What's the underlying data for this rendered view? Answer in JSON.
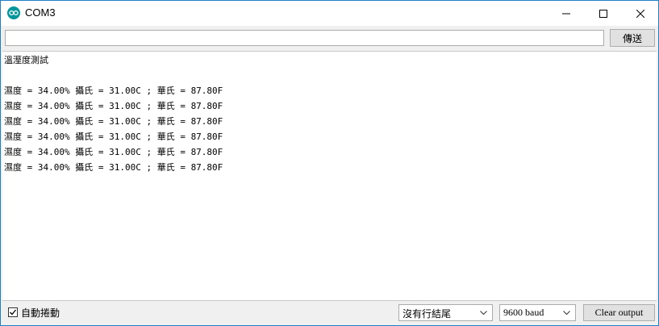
{
  "window": {
    "title": "COM3"
  },
  "send": {
    "input_value": "",
    "button_label": "傳送"
  },
  "output": {
    "lines": [
      "溫溼度測試",
      "",
      "濕度 = 34.00% 攝氏 = 31.00C ; 華氏 = 87.80F",
      "濕度 = 34.00% 攝氏 = 31.00C ; 華氏 = 87.80F",
      "濕度 = 34.00% 攝氏 = 31.00C ; 華氏 = 87.80F",
      "濕度 = 34.00% 攝氏 = 31.00C ; 華氏 = 87.80F",
      "濕度 = 34.00% 攝氏 = 31.00C ; 華氏 = 87.80F",
      "濕度 = 34.00% 攝氏 = 31.00C ; 華氏 = 87.80F"
    ]
  },
  "footer": {
    "autoscroll_label": "自動捲動",
    "autoscroll_checked": true,
    "line_ending": "沒有行結尾",
    "baud": "9600 baud",
    "clear_label": "Clear output"
  },
  "icons": {
    "app": "arduino-icon",
    "minimize": "minimize-icon",
    "maximize": "maximize-icon",
    "close": "close-icon",
    "dropdown": "chevron-down-icon",
    "check": "check-icon"
  },
  "colors": {
    "window_border": "#1f80c9",
    "app_icon": "#00979c"
  }
}
